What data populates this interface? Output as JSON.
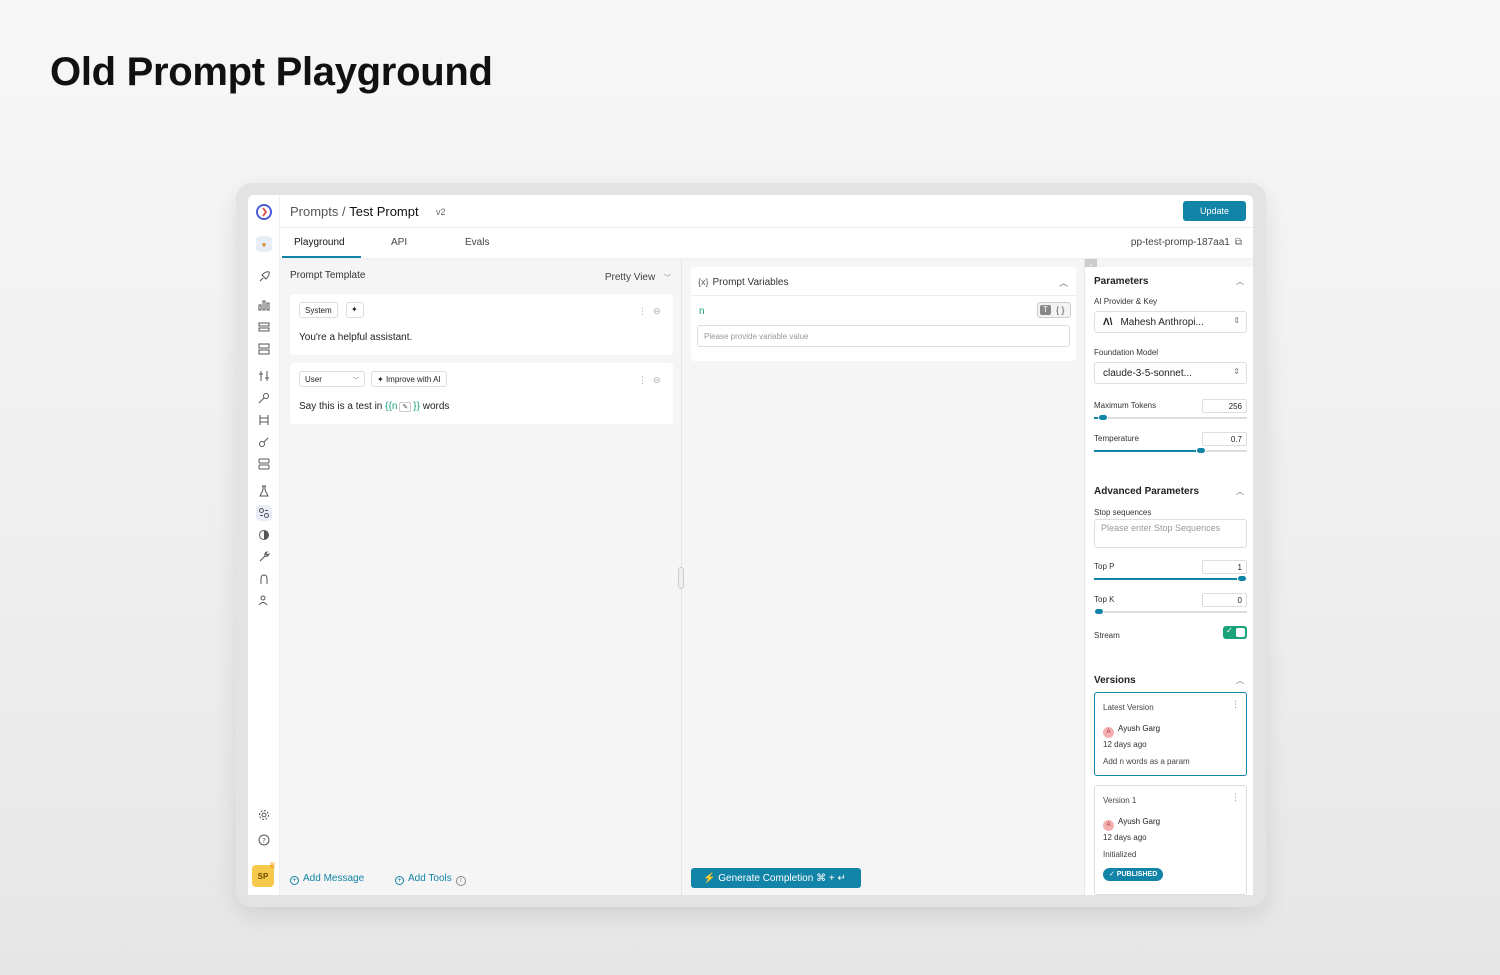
{
  "page_title": "Old Prompt Playground",
  "header": {
    "breadcrumb_root": "Prompts /",
    "breadcrumb_current": "Test Prompt",
    "version": "v2",
    "update_label": "Update"
  },
  "tabs": [
    {
      "label": "Playground"
    },
    {
      "label": "API"
    },
    {
      "label": "Evals"
    }
  ],
  "prompt_slug": "pp-test-promp-187aa1",
  "template": {
    "title": "Prompt Template",
    "view_mode": "Pretty View",
    "messages": [
      {
        "role": "System",
        "text": "You're a helpful assistant."
      },
      {
        "role": "User",
        "improve_label": "Improve with AI",
        "text_before": "Say this is a test in ",
        "var_open": "{{n",
        "var_close": "}}",
        "text_after": " words"
      }
    ],
    "add_message_label": "Add Message",
    "add_tools_label": "Add Tools"
  },
  "variables": {
    "title": "Prompt Variables",
    "icon_text": "{x}",
    "name": "n",
    "toggle_text": "T",
    "toggle_json": "{ }",
    "placeholder": "Please provide variable value"
  },
  "generate_label": "Generate Completion ⌘ + ↵",
  "parameters": {
    "title": "Parameters",
    "provider_label": "AI Provider & Key",
    "provider_value": "Mahesh Anthropi...",
    "model_label": "Foundation Model",
    "model_value": "claude-3-5-sonnet...",
    "max_tokens_label": "Maximum Tokens",
    "max_tokens_value": "256",
    "max_tokens_level": 0.06,
    "temperature_label": "Temperature",
    "temperature_value": "0.7",
    "temperature_level": 0.7
  },
  "advanced": {
    "title": "Advanced Parameters",
    "stop_label": "Stop sequences",
    "stop_placeholder": "Please enter Stop Sequences",
    "top_p_label": "Top P",
    "top_p_value": "1",
    "top_p_level": 1.0,
    "top_k_label": "Top K",
    "top_k_value": "0",
    "top_k_level": 0.0,
    "stream_label": "Stream",
    "stream_on": true
  },
  "versions": {
    "title": "Versions",
    "items": [
      {
        "title": "Latest Version",
        "user_initial": "A",
        "user": "Ayush Garg",
        "time": "12 days ago",
        "note": "Add n words as a param"
      },
      {
        "title": "Version 1",
        "user_initial": "A",
        "user": "Ayush Garg",
        "time": "12 days ago",
        "note": "Initialized",
        "badge": "✓ PUBLISHED"
      }
    ]
  },
  "user_avatar": "SP",
  "colors": {
    "accent": "#1184a7",
    "variable": "#13a07a",
    "stream_on": "#1aa37a"
  }
}
